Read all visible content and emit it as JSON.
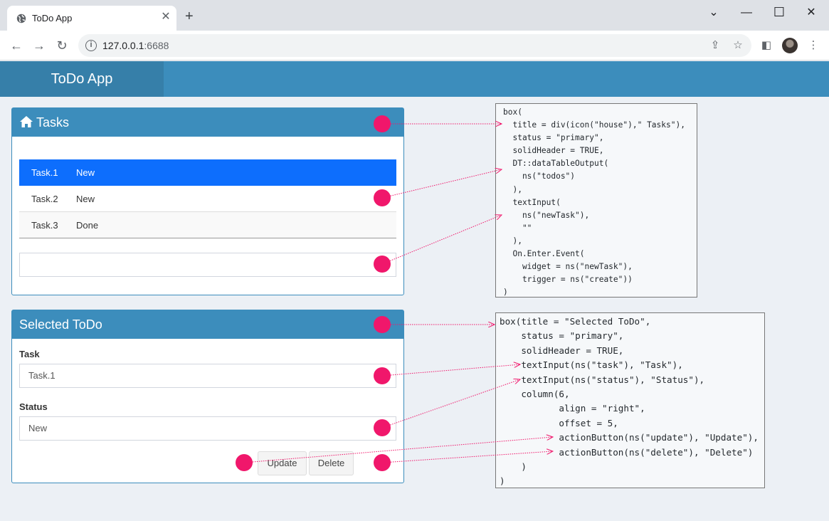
{
  "browser": {
    "tab_title": "ToDo App",
    "new_tab": "+",
    "url_host": "127.0.0.1",
    "url_port": ":6688",
    "window_controls": [
      "minimize-icon",
      "maximize-icon",
      "close-icon"
    ]
  },
  "app": {
    "title": "ToDo App",
    "accent": "#3c8dbc",
    "marker_color": "#f0176b"
  },
  "tasks_box": {
    "title": "Tasks",
    "icon": "house-icon",
    "rows": [
      {
        "task": "Task.1",
        "status": "New",
        "selected": true
      },
      {
        "task": "Task.2",
        "status": "New",
        "selected": false
      },
      {
        "task": "Task.3",
        "status": "Done",
        "selected": false
      }
    ],
    "new_task_value": ""
  },
  "selected_box": {
    "title": "Selected ToDo",
    "task_label": "Task",
    "task_value": "Task.1",
    "status_label": "Status",
    "status_value": "New",
    "update_label": "Update",
    "delete_label": "Delete"
  },
  "code_a": [
    "box(",
    "  title = div(icon(\"house\"),\" Tasks\"),",
    "  status = \"primary\",",
    "  solidHeader = TRUE,",
    "  DT::dataTableOutput(",
    "    ns(\"todos\")",
    "  ),",
    "  textInput(",
    "    ns(\"newTask\"),",
    "    \"\"",
    "  ),",
    "  On.Enter.Event(",
    "    widget = ns(\"newTask\"),",
    "    trigger = ns(\"create\"))",
    ")"
  ],
  "code_b": [
    "box(title = \"Selected ToDo\",",
    "    status = \"primary\",",
    "    solidHeader = TRUE,",
    "    textInput(ns(\"task\"), \"Task\"),",
    "    textInput(ns(\"status\"), \"Status\"),",
    "    column(6,",
    "           align = \"right\",",
    "           offset = 5,",
    "           actionButton(ns(\"update\"), \"Update\"),",
    "           actionButton(ns(\"delete\"), \"Delete\")",
    "    )",
    ")"
  ]
}
